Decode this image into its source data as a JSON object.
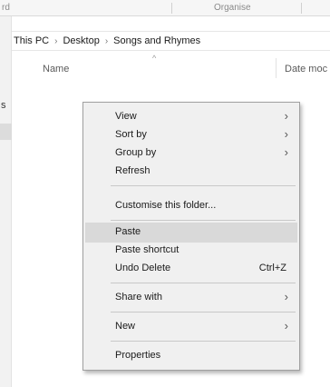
{
  "ribbon": {
    "left_fragment": "rd",
    "organise_label": "Organise"
  },
  "nav_pane": {
    "fragment": "s"
  },
  "address": {
    "crumbs": [
      "This PC",
      "Desktop",
      "Songs and Rhymes"
    ],
    "separator": "›"
  },
  "columns": {
    "name": "Name",
    "sort_indicator": "^",
    "date_modified": "Date moc"
  },
  "context_menu": {
    "items": [
      {
        "label": "View",
        "arrow": "›"
      },
      {
        "label": "Sort by",
        "arrow": "›"
      },
      {
        "label": "Group by",
        "arrow": "›"
      },
      {
        "label": "Refresh"
      },
      {
        "label": "Customise this folder..."
      },
      {
        "label": "Paste",
        "highlighted": true
      },
      {
        "label": "Paste shortcut"
      },
      {
        "label": "Undo Delete",
        "shortcut": "Ctrl+Z"
      },
      {
        "label": "Share with",
        "arrow": "›"
      },
      {
        "label": "New",
        "arrow": "›"
      },
      {
        "label": "Properties"
      }
    ]
  },
  "colors": {
    "desktop": "#58a8d6",
    "menu_bg": "#f0f0f0",
    "menu_highlight": "#d9d9d9"
  }
}
